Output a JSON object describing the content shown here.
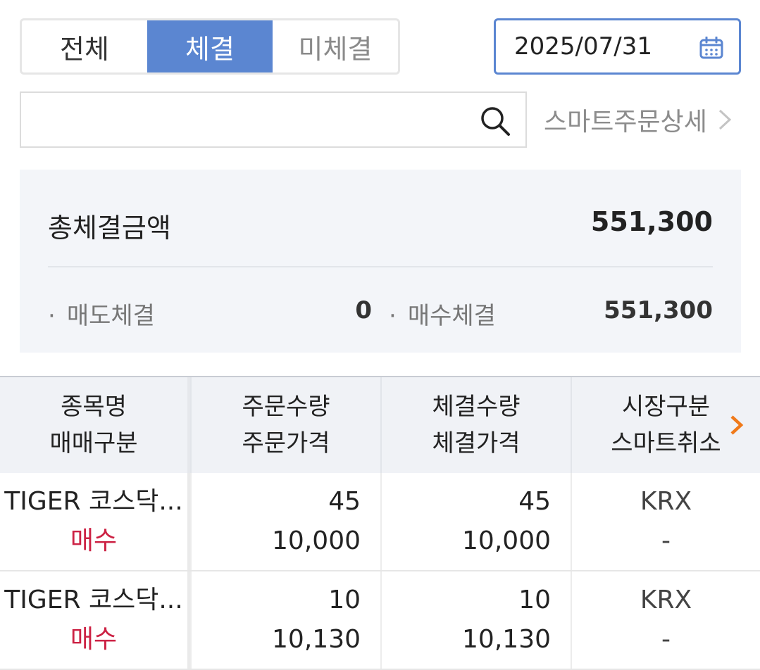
{
  "tabs": [
    {
      "label": "전체",
      "active": false
    },
    {
      "label": "체결",
      "active": true
    },
    {
      "label": "미체결",
      "active": false
    }
  ],
  "date": "2025/07/31",
  "search": {
    "placeholder": ""
  },
  "smart_order_link": "스마트주문상세",
  "summary": {
    "title": "총체결금액",
    "total": "551,300",
    "sell_label": "매도체결",
    "sell_value": "0",
    "buy_label": "매수체결",
    "buy_value": "551,300"
  },
  "table": {
    "headers": [
      [
        "종목명",
        "매매구분"
      ],
      [
        "주문수량",
        "주문가격"
      ],
      [
        "체결수량",
        "체결가격"
      ],
      [
        "시장구분",
        "스마트취소"
      ]
    ],
    "rows": [
      {
        "name": "TIGER 코스닥...",
        "side": "매수",
        "order_qty": "45",
        "order_price": "10,000",
        "exec_qty": "45",
        "exec_price": "10,000",
        "market": "KRX",
        "smart_cancel": "-"
      },
      {
        "name": "TIGER 코스닥...",
        "side": "매수",
        "order_qty": "10",
        "order_price": "10,130",
        "exec_qty": "10",
        "exec_price": "10,130",
        "market": "KRX",
        "smart_cancel": "-"
      }
    ]
  },
  "colors": {
    "accent": "#5b86d1",
    "buy": "#cc2244",
    "more_arrow": "#f07a1a"
  },
  "icons": {
    "date": "calendar-icon",
    "search": "search-icon",
    "link": "chevron-right-icon",
    "more": "chevron-right-orange-icon"
  }
}
